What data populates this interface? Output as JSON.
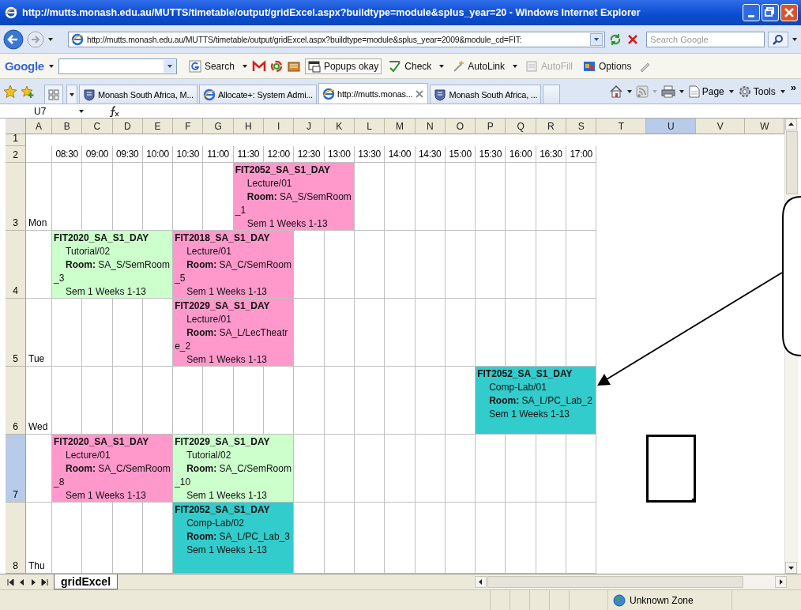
{
  "window": {
    "title": "http://mutts.monash.edu.au/MUTTS/timetable/output/gridExcel.aspx?buildtype=module&splus_year=20 - Windows Internet Explorer"
  },
  "address_bar": {
    "url": "http://mutts.monash.edu.au/MUTTS/timetable/output/gridExcel.aspx?buildtype=module&splus_year=2009&module_cd=FIT:",
    "search_placeholder": "Search Google"
  },
  "google_toolbar": {
    "logo": "Google",
    "items": [
      {
        "kind": "search",
        "label": "Search",
        "disabled": false
      },
      {
        "kind": "popups",
        "label": "Popups okay",
        "disabled": false
      },
      {
        "kind": "check",
        "label": "Check",
        "disabled": false
      },
      {
        "kind": "autolink",
        "label": "AutoLink",
        "disabled": false
      },
      {
        "kind": "autofill",
        "label": "AutoFill",
        "disabled": true
      },
      {
        "kind": "options",
        "label": "Options",
        "disabled": false
      }
    ]
  },
  "tabs": [
    {
      "kind": "crest",
      "label": "Monash South Africa, M...",
      "selected": false
    },
    {
      "kind": "ie",
      "label": "Allocate+: System Admi...",
      "selected": false
    },
    {
      "kind": "ie",
      "label": "http://mutts.monas...",
      "selected": true
    },
    {
      "kind": "crest",
      "label": "Monash South Africa, ...",
      "selected": false
    }
  ],
  "command_bar": {
    "items": [
      {
        "kind": "page",
        "label": "Page"
      },
      {
        "kind": "tools",
        "label": "Tools"
      }
    ],
    "more": "»"
  },
  "formula_bar": {
    "name_box": "U7"
  },
  "sheet": {
    "columns": [
      {
        "letter": "A",
        "selected": false
      },
      {
        "letter": "B",
        "selected": false
      },
      {
        "letter": "C",
        "selected": false
      },
      {
        "letter": "D",
        "selected": false
      },
      {
        "letter": "E",
        "selected": false
      },
      {
        "letter": "F",
        "selected": false
      },
      {
        "letter": "G",
        "selected": false
      },
      {
        "letter": "H",
        "selected": false
      },
      {
        "letter": "I",
        "selected": false
      },
      {
        "letter": "J",
        "selected": false
      },
      {
        "letter": "K",
        "selected": false
      },
      {
        "letter": "L",
        "selected": false
      },
      {
        "letter": "M",
        "selected": false
      },
      {
        "letter": "N",
        "selected": false
      },
      {
        "letter": "O",
        "selected": false
      },
      {
        "letter": "P",
        "selected": false
      },
      {
        "letter": "Q",
        "selected": false
      },
      {
        "letter": "R",
        "selected": false
      },
      {
        "letter": "S",
        "selected": false
      },
      {
        "letter": "T",
        "selected": false
      },
      {
        "letter": "U",
        "selected": true
      },
      {
        "letter": "V",
        "selected": false
      },
      {
        "letter": "W",
        "selected": false
      }
    ],
    "times": [
      "08:30",
      "09:00",
      "09:30",
      "10:00",
      "10:30",
      "11:00",
      "11:30",
      "12:00",
      "12:30",
      "13:00",
      "13:30",
      "14:00",
      "14:30",
      "15:00",
      "15:30",
      "16:00",
      "16:30",
      "17:00"
    ],
    "rows": [
      {
        "number": "1",
        "selected": false
      },
      {
        "number": "2",
        "selected": false,
        "kind": "times"
      },
      {
        "number": "3",
        "selected": false,
        "day": "Mon",
        "cells": [
          {
            "kind": "empty"
          },
          {
            "kind": "empty"
          },
          {
            "kind": "empty"
          },
          {
            "kind": "empty"
          },
          {
            "kind": "empty"
          },
          {
            "kind": "empty"
          },
          {
            "kind": "event",
            "code": "FIT2052_SA_S1_DAY",
            "activity": "Lecture/01",
            "room": "**Room:** SA_S/SemRoom_1",
            "weeks": "Sem 1 Weeks 1-13",
            "color": "#ff99cc"
          },
          {
            "kind": "merged"
          },
          {
            "kind": "merged"
          },
          {
            "kind": "merged"
          },
          {
            "kind": "empty"
          },
          {
            "kind": "empty"
          },
          {
            "kind": "empty"
          },
          {
            "kind": "empty"
          },
          {
            "kind": "empty"
          },
          {
            "kind": "empty"
          },
          {
            "kind": "empty"
          },
          {
            "kind": "empty"
          }
        ]
      },
      {
        "number": "4",
        "selected": false,
        "cells": [
          {
            "kind": "event",
            "code": "FIT2020_SA_S1_DAY",
            "activity": "Tutorial/02",
            "room": "**Room:** SA_S/SemRoom_3",
            "weeks": "Sem 1 Weeks 1-13",
            "color": "#ccffcc"
          },
          {
            "kind": "merged"
          },
          {
            "kind": "merged"
          },
          {
            "kind": "merged"
          },
          {
            "kind": "event",
            "code": "FIT2018_SA_S1_DAY",
            "activity": "Lecture/01",
            "room": "**Room:** SA_C/SemRoom_5",
            "weeks": "Sem 1 Weeks 1-13",
            "color": "#ff99cc"
          },
          {
            "kind": "merged"
          },
          {
            "kind": "merged"
          },
          {
            "kind": "merged"
          },
          {
            "kind": "empty"
          },
          {
            "kind": "empty"
          },
          {
            "kind": "empty"
          },
          {
            "kind": "empty"
          },
          {
            "kind": "empty"
          },
          {
            "kind": "empty"
          },
          {
            "kind": "empty"
          },
          {
            "kind": "empty"
          },
          {
            "kind": "empty"
          },
          {
            "kind": "empty"
          }
        ]
      },
      {
        "number": "5",
        "selected": false,
        "day": "Tue",
        "cells": [
          {
            "kind": "empty"
          },
          {
            "kind": "empty"
          },
          {
            "kind": "empty"
          },
          {
            "kind": "empty"
          },
          {
            "kind": "event",
            "code": "FIT2029_SA_S1_DAY",
            "activity": "Lecture/01",
            "room": "**Room:** SA_L/LecTheatre_2",
            "weeks": "Sem 1 Weeks 1-13",
            "color": "#ff99cc"
          },
          {
            "kind": "merged"
          },
          {
            "kind": "merged"
          },
          {
            "kind": "merged"
          },
          {
            "kind": "empty"
          },
          {
            "kind": "empty"
          },
          {
            "kind": "empty"
          },
          {
            "kind": "empty"
          },
          {
            "kind": "empty"
          },
          {
            "kind": "empty"
          },
          {
            "kind": "empty"
          },
          {
            "kind": "empty"
          },
          {
            "kind": "empty"
          },
          {
            "kind": "empty"
          }
        ]
      },
      {
        "number": "6",
        "selected": false,
        "day": "Wed",
        "cells": [
          {
            "kind": "empty"
          },
          {
            "kind": "empty"
          },
          {
            "kind": "empty"
          },
          {
            "kind": "empty"
          },
          {
            "kind": "empty"
          },
          {
            "kind": "empty"
          },
          {
            "kind": "empty"
          },
          {
            "kind": "empty"
          },
          {
            "kind": "empty"
          },
          {
            "kind": "empty"
          },
          {
            "kind": "empty"
          },
          {
            "kind": "empty"
          },
          {
            "kind": "empty"
          },
          {
            "kind": "empty"
          },
          {
            "kind": "event",
            "code": "FIT2052_SA_S1_DAY",
            "activity": "Comp-Lab/01",
            "room": "**Room:** SA_L/PC_Lab_2",
            "weeks": "Sem 1 Weeks 1-13",
            "color": "#33cccc"
          },
          {
            "kind": "merged"
          },
          {
            "kind": "merged"
          },
          {
            "kind": "merged"
          }
        ]
      },
      {
        "number": "7",
        "selected": true,
        "cells": [
          {
            "kind": "event",
            "code": "FIT2020_SA_S1_DAY",
            "activity": "Lecture/01",
            "room": "**Room:** SA_C/SemRoom_8",
            "weeks": "Sem 1 Weeks 1-13",
            "color": "#ff99cc"
          },
          {
            "kind": "merged"
          },
          {
            "kind": "merged"
          },
          {
            "kind": "merged"
          },
          {
            "kind": "event",
            "code": "FIT2029_SA_S1_DAY",
            "activity": "Tutorial/02",
            "room": "**Room:** SA_C/SemRoom_10",
            "weeks": "Sem 1 Weeks 1-13",
            "color": "#ccffcc"
          },
          {
            "kind": "merged"
          },
          {
            "kind": "merged"
          },
          {
            "kind": "merged"
          },
          {
            "kind": "empty"
          },
          {
            "kind": "empty"
          },
          {
            "kind": "empty"
          },
          {
            "kind": "empty"
          },
          {
            "kind": "empty"
          },
          {
            "kind": "empty"
          },
          {
            "kind": "empty"
          },
          {
            "kind": "empty"
          },
          {
            "kind": "empty"
          },
          {
            "kind": "empty"
          }
        ]
      },
      {
        "number": "8",
        "selected": false,
        "day": "Thu",
        "cells": [
          {
            "kind": "empty"
          },
          {
            "kind": "empty"
          },
          {
            "kind": "empty"
          },
          {
            "kind": "empty"
          },
          {
            "kind": "event",
            "code": "FIT2052_SA_S1_DAY",
            "activity": "Comp-Lab/02",
            "room": "**Room:** SA_L/PC_Lab_3",
            "weeks": "Sem 1 Weeks 1-13",
            "color": "#33cccc"
          },
          {
            "kind": "merged"
          },
          {
            "kind": "merged"
          },
          {
            "kind": "merged"
          },
          {
            "kind": "empty"
          },
          {
            "kind": "empty"
          },
          {
            "kind": "empty"
          },
          {
            "kind": "empty"
          },
          {
            "kind": "empty"
          },
          {
            "kind": "empty"
          },
          {
            "kind": "empty"
          },
          {
            "kind": "empty"
          },
          {
            "kind": "empty"
          },
          {
            "kind": "empty"
          }
        ]
      }
    ],
    "sheet_tab": "gridExcel"
  },
  "status_bar": {
    "zone": "Unknown Zone"
  }
}
